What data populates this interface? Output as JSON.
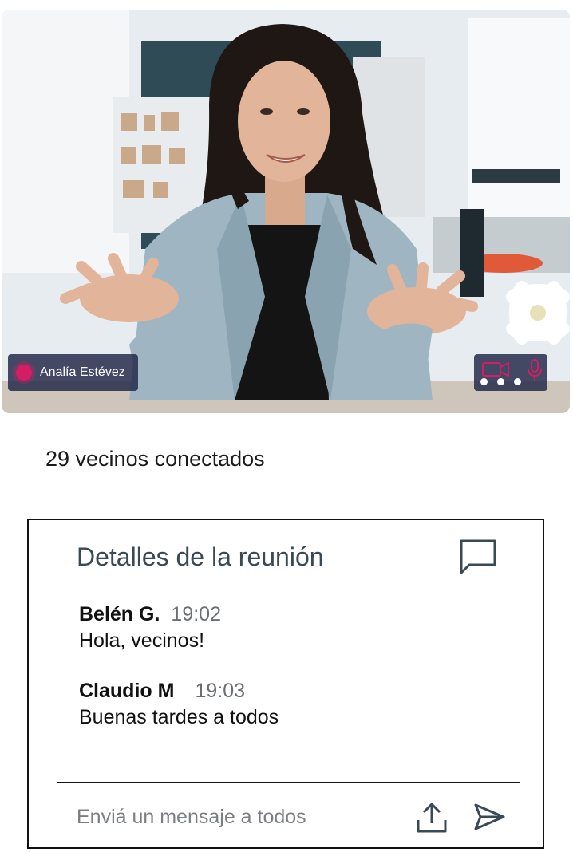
{
  "video": {
    "participant_name": "Analía Estévez",
    "icons": [
      "record-dot",
      "camera-icon",
      "microphone-icon",
      "more-options-icon"
    ],
    "accent_color": "#d41d63"
  },
  "status": {
    "connected_text": "29 vecinos conectados"
  },
  "panel": {
    "title": "Detalles de la reunión",
    "title_icon": "chat-bubble-icon",
    "messages": [
      {
        "author": "Belén G.",
        "time": "19:02",
        "text": "Hola, vecinos!"
      },
      {
        "author": "Claudio M",
        "time": "19:03",
        "text": "Buenas tardes a todos"
      }
    ],
    "input_placeholder": "Enviá un mensaje a todos",
    "input_value": "",
    "upload_icon": "upload-icon",
    "send_icon": "send-icon"
  }
}
